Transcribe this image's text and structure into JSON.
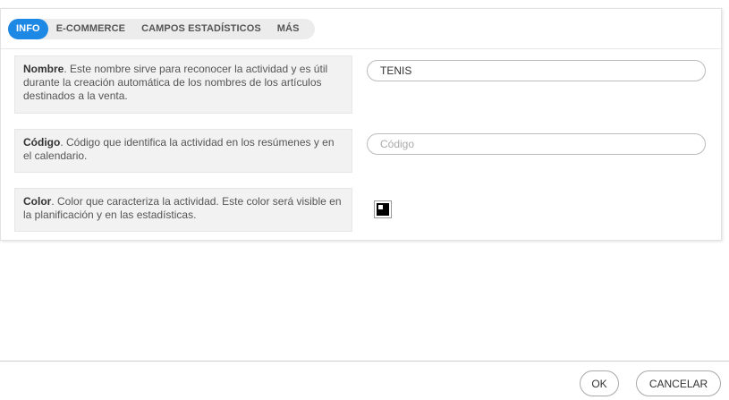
{
  "tabs": [
    {
      "label": "INFO",
      "active": true
    },
    {
      "label": "E-COMMERCE",
      "active": false
    },
    {
      "label": "CAMPOS ESTADÍSTICOS",
      "active": false
    },
    {
      "label": "MÁS",
      "active": false
    }
  ],
  "fields": {
    "nombre": {
      "label": "Nombre",
      "description": ". Este nombre sirve para reconocer la actividad y es útil durante la creación automática de los nombres de los artículos destinados a la venta.",
      "value": "TENIS"
    },
    "codigo": {
      "label": "Código",
      "description": ". Código que identifica la actividad en los resúmenes y en el calendario.",
      "placeholder": "Código"
    },
    "color": {
      "label": "Color",
      "description": ". Color que caracteriza la actividad. Este color será visible en la planificación y en las estadísticas.",
      "value": "#000000"
    }
  },
  "footer": {
    "ok_label": "OK",
    "cancel_label": "CANCELAR"
  },
  "colors": {
    "accent": "#1e88e5",
    "label_bg": "#f2f2f2"
  }
}
